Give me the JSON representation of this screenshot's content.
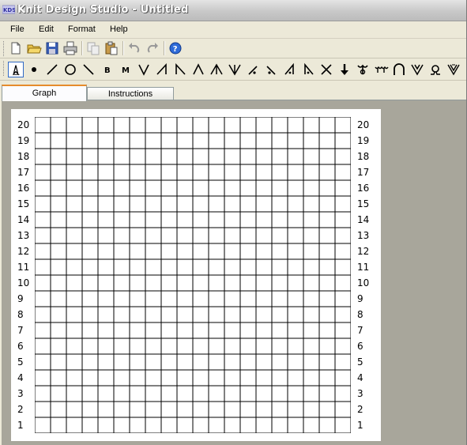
{
  "window": {
    "title": "Knit Design Studio - Untitled",
    "app_icon": "kds-app-icon"
  },
  "menu": [
    "File",
    "Edit",
    "Format",
    "Help"
  ],
  "toolbar": {
    "buttons": [
      "new-file-icon",
      "open-folder-icon",
      "save-icon",
      "print-icon",
      "copy-icon",
      "paste-icon",
      "undo-icon",
      "redo-icon",
      "help-icon"
    ]
  },
  "symbols": {
    "items": [
      "pointer",
      "knit-dot",
      "slash-right",
      "purl-circle",
      "slash-left",
      "bobble-b",
      "make-one-m",
      "v-stitch",
      "right-lean-decrease",
      "left-lean-decrease",
      "double-decrease",
      "triple-decrease",
      "v-decrease",
      "dot-right-lean",
      "dot-left-lean",
      "right-decrease-dot",
      "left-decrease-dot",
      "cross",
      "down-arrow",
      "twist",
      "double-twist",
      "arch",
      "v-cable",
      "omega",
      "v-wedge"
    ],
    "active": "pointer"
  },
  "tabs": [
    {
      "label": "Graph",
      "selected": true
    },
    {
      "label": "Instructions",
      "selected": false
    }
  ],
  "chart": {
    "rows": 20,
    "cols": 20,
    "row_labels_left": [
      "20",
      "19",
      "18",
      "17",
      "16",
      "15",
      "14",
      "13",
      "12",
      "11",
      "10",
      "9",
      "8",
      "7",
      "6",
      "5",
      "4",
      "3",
      "2",
      "1"
    ],
    "row_labels_right": [
      "20",
      "19",
      "18",
      "17",
      "16",
      "15",
      "14",
      "13",
      "12",
      "11",
      "10",
      "9",
      "8",
      "7",
      "6",
      "5",
      "4",
      "3",
      "2",
      "1"
    ]
  }
}
